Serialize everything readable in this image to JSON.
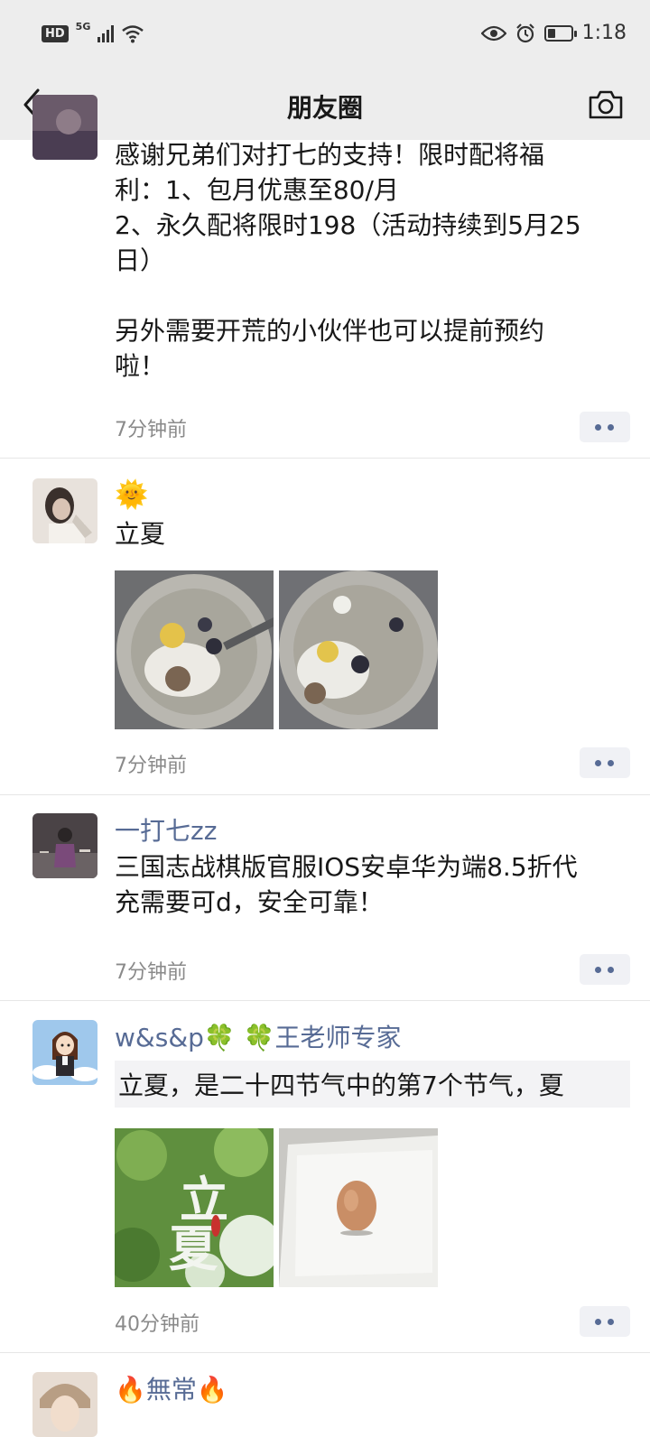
{
  "status": {
    "hd": "HD",
    "network": "5G",
    "time": "1:18",
    "battery_level": 0.35
  },
  "nav": {
    "title": "朋友圈",
    "back_icon": "chevron-left-icon",
    "camera_icon": "camera-icon"
  },
  "posts": [
    {
      "text": "感谢兄弟们对打七的支持！限时配将福\n利：1、包月优惠至80/月\n2、永久配将限时198（活动持续到5月25\n日）\n\n另外需要开荒的小伙伴也可以提前预约\n啦！",
      "time": "7分钟前"
    },
    {
      "emoji": "🌞",
      "text": "立夏",
      "time": "7分钟前"
    },
    {
      "name": "一打七zz",
      "text": "三国志战棋版官服IOS安卓华为端8.5折代\n充需要可d，安全可靠！",
      "time": "7分钟前"
    },
    {
      "name": "w&s&p🍀 🍀王老师专家",
      "quoted_text": "立夏，是二十四节气中的第7个节气，夏",
      "time": "40分钟前"
    },
    {
      "name": "🔥無常🔥"
    }
  ]
}
